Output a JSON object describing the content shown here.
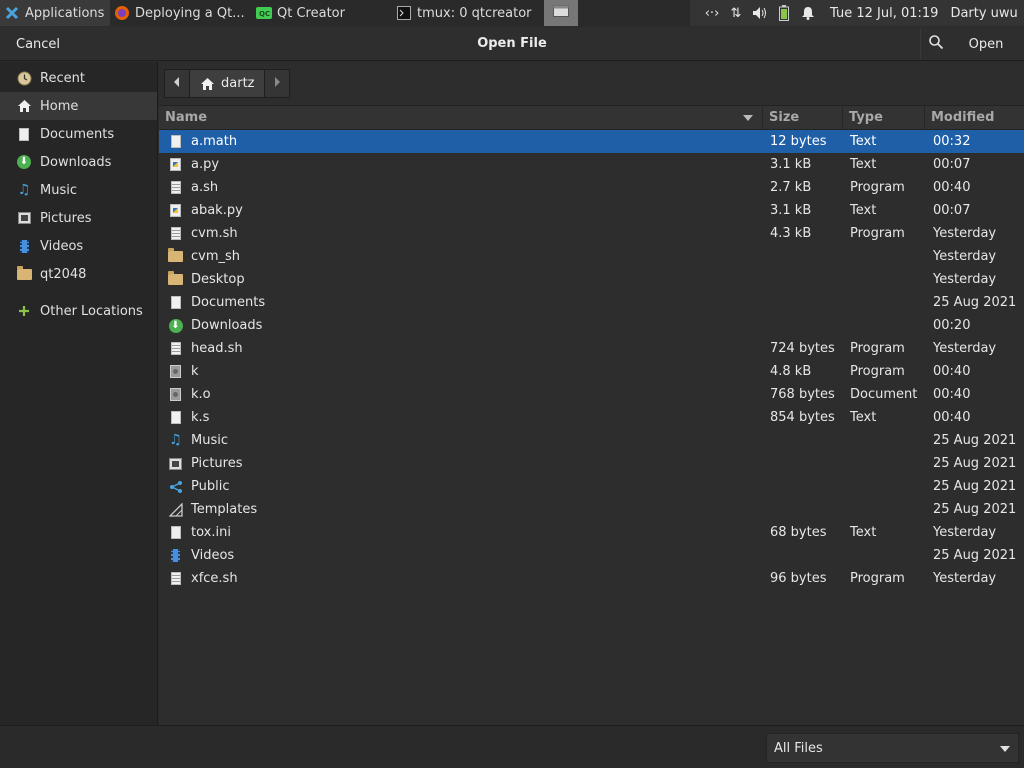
{
  "taskbar": {
    "apps_label": "Applications",
    "firefox_task": "Deploying a Qt...",
    "qtcreator_task": "Qt Creator",
    "tmux_task": "tmux: 0 qtcreator",
    "clock": "Tue 12 Jul, 01:19",
    "user": "Darty uwu"
  },
  "dialog": {
    "cancel_label": "Cancel",
    "title": "Open File",
    "open_label": "Open"
  },
  "sidebar": {
    "items": [
      {
        "label": "Recent",
        "icon": "clock-icon"
      },
      {
        "label": "Home",
        "icon": "home-icon"
      },
      {
        "label": "Documents",
        "icon": "document-icon"
      },
      {
        "label": "Downloads",
        "icon": "download-icon"
      },
      {
        "label": "Music",
        "icon": "music-icon"
      },
      {
        "label": "Pictures",
        "icon": "picture-icon"
      },
      {
        "label": "Videos",
        "icon": "video-icon"
      },
      {
        "label": "qt2048",
        "icon": "folder-icon"
      },
      {
        "label": "Other Locations",
        "icon": "plus-icon"
      }
    ]
  },
  "path": {
    "current": "dartz"
  },
  "columns": {
    "name": "Name",
    "size": "Size",
    "type": "Type",
    "modified": "Modified"
  },
  "files": [
    {
      "name": "a.math",
      "size": "12 bytes",
      "type": "Text",
      "modified": "00:32",
      "icon": "text-file-icon"
    },
    {
      "name": "a.py",
      "size": "3.1 kB",
      "type": "Text",
      "modified": "00:07",
      "icon": "python-file-icon"
    },
    {
      "name": "a.sh",
      "size": "2.7 kB",
      "type": "Program",
      "modified": "00:40",
      "icon": "script-file-icon"
    },
    {
      "name": "abak.py",
      "size": "3.1 kB",
      "type": "Text",
      "modified": "00:07",
      "icon": "python-file-icon"
    },
    {
      "name": "cvm.sh",
      "size": "4.3 kB",
      "type": "Program",
      "modified": "Yesterday",
      "icon": "script-file-icon"
    },
    {
      "name": "cvm_sh",
      "size": "",
      "type": "",
      "modified": "Yesterday",
      "icon": "folder-icon"
    },
    {
      "name": "Desktop",
      "size": "",
      "type": "",
      "modified": "Yesterday",
      "icon": "folder-icon"
    },
    {
      "name": "Documents",
      "size": "",
      "type": "",
      "modified": "25 Aug 2021",
      "icon": "document-folder-icon"
    },
    {
      "name": "Downloads",
      "size": "",
      "type": "",
      "modified": "00:20",
      "icon": "download-folder-icon"
    },
    {
      "name": "head.sh",
      "size": "724 bytes",
      "type": "Program",
      "modified": "Yesterday",
      "icon": "script-file-icon"
    },
    {
      "name": "k",
      "size": "4.8 kB",
      "type": "Program",
      "modified": "00:40",
      "icon": "executable-file-icon"
    },
    {
      "name": "k.o",
      "size": "768 bytes",
      "type": "Document",
      "modified": "00:40",
      "icon": "executable-file-icon"
    },
    {
      "name": "k.s",
      "size": "854 bytes",
      "type": "Text",
      "modified": "00:40",
      "icon": "text-file-icon"
    },
    {
      "name": "Music",
      "size": "",
      "type": "",
      "modified": "25 Aug 2021",
      "icon": "music-folder-icon"
    },
    {
      "name": "Pictures",
      "size": "",
      "type": "",
      "modified": "25 Aug 2021",
      "icon": "picture-folder-icon"
    },
    {
      "name": "Public",
      "size": "",
      "type": "",
      "modified": "25 Aug 2021",
      "icon": "share-folder-icon"
    },
    {
      "name": "Templates",
      "size": "",
      "type": "",
      "modified": "25 Aug 2021",
      "icon": "template-folder-icon"
    },
    {
      "name": "tox.ini",
      "size": "68 bytes",
      "type": "Text",
      "modified": "Yesterday",
      "icon": "text-file-icon"
    },
    {
      "name": "Videos",
      "size": "",
      "type": "",
      "modified": "25 Aug 2021",
      "icon": "video-folder-icon"
    },
    {
      "name": "xfce.sh",
      "size": "96 bytes",
      "type": "Program",
      "modified": "Yesterday",
      "icon": "script-file-icon"
    }
  ],
  "filter": {
    "selected": "All Files"
  },
  "colors": {
    "selection": "#1f5fa8",
    "background": "#2d2d2d"
  }
}
